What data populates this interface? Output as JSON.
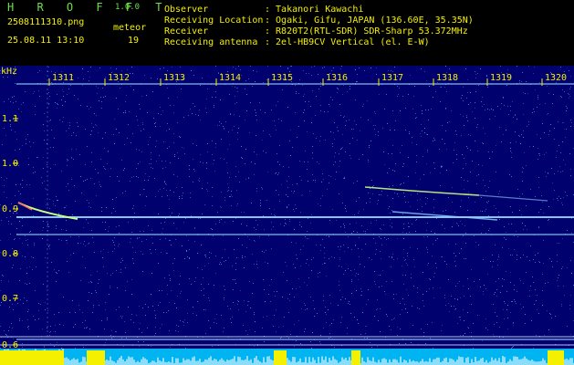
{
  "header": {
    "brand": "H R O F F T",
    "version": "1.0.0",
    "filename": "2508111310.png",
    "datetime": "25.08.11 13:10",
    "meteor_label": "meteor",
    "meteor_count": "19",
    "info": [
      {
        "label": "Observer",
        "value": ": Takanori Kawachi"
      },
      {
        "label": "Receiving Location",
        "value": ": Ogaki, Gifu, JAPAN (136.60E, 35.35N)"
      },
      {
        "label": "Receiver",
        "value": ": R820T2(RTL-SDR) SDR-Sharp 53.372MHz"
      },
      {
        "label": "Receiving antenna",
        "value": ": 2el-HB9CV Vertical (el. E-W)"
      }
    ]
  },
  "spectrogram": {
    "y_unit": "kHz",
    "y_ticks": [
      "1.1",
      "1.0",
      "0.9",
      "0.8",
      "0.7",
      "0.6"
    ],
    "x_ticks": [
      "1311",
      "1312",
      "1313",
      "1314",
      "1315",
      "1316",
      "1317",
      "1318",
      "1319",
      "1320"
    ],
    "background_color": "#00006e",
    "carrier_color": "#8fd0ff",
    "meteor_color": "#c8ff80",
    "level_bar_color": "#f4f000"
  }
}
